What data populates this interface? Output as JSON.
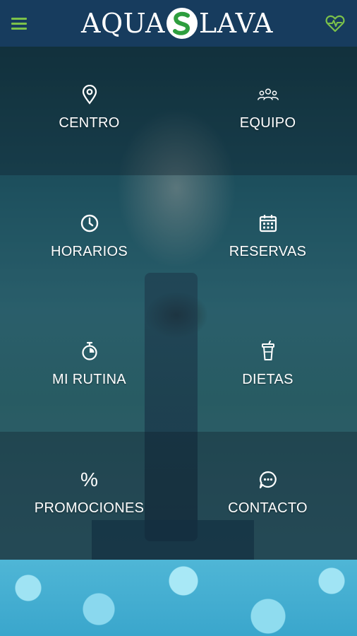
{
  "header": {
    "logo_text_left": "AQUA",
    "logo_text_right": "LAVA",
    "menu_icon": "hamburger-menu-icon",
    "health_icon": "heart-pulse-icon",
    "brand_color": "#173c5e",
    "accent_color": "#7cc24a"
  },
  "menu": {
    "centro": {
      "label": "CENTRO",
      "icon": "location-pin-icon"
    },
    "equipo": {
      "label": "EQUIPO",
      "icon": "team-icon"
    },
    "horarios": {
      "label": "HORARIOS",
      "icon": "clock-icon"
    },
    "reservas": {
      "label": "RESERVAS",
      "icon": "calendar-icon"
    },
    "rutina": {
      "label": "MI RUTINA",
      "icon": "stopwatch-icon"
    },
    "dietas": {
      "label": "DIETAS",
      "icon": "drink-cup-icon"
    },
    "promociones": {
      "label": "PROMOCIONES",
      "icon_glyph": "%",
      "icon": "percent-icon"
    },
    "contacto": {
      "label": "CONTACTO",
      "icon": "chat-bubble-icon"
    }
  }
}
